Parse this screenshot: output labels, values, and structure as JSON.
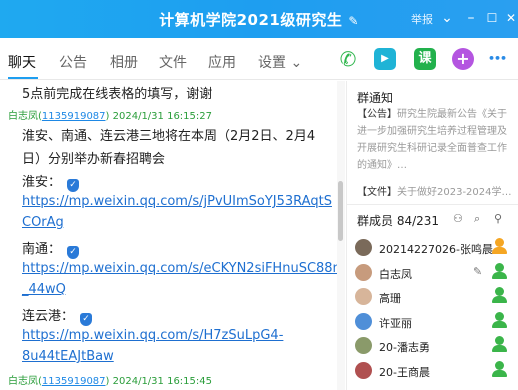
{
  "window": {
    "title": "计算机学院2021级研究生",
    "edit_glyph": "✎",
    "report": "举报",
    "btn_chevron": "⌄",
    "btn_min": "–",
    "btn_max": "☐",
    "btn_close": "✕"
  },
  "tabs": [
    {
      "label": "聊天"
    },
    {
      "label": "公告"
    },
    {
      "label": "相册"
    },
    {
      "label": "文件"
    },
    {
      "label": "应用"
    },
    {
      "label": "设置 ⌄"
    }
  ],
  "actions": {
    "call": "✆",
    "video": "▶",
    "class": "课",
    "add": "+",
    "more": "•••"
  },
  "colors": {
    "accent": "#1e9ef0",
    "owner": "#f5a623",
    "admin": "#3bb54a",
    "link": "#1e6fd0"
  },
  "chat": {
    "line0": "5点前完成在线表格的填写，谢谢",
    "msg1": {
      "name": "白志凤",
      "qq": "1135919087",
      "time": "2024/1/31 16:15:27"
    },
    "line1": "淮安、南通、连云港三地将在本周（2月2日、2月4",
    "line2": "日）分别举办新春招聘会",
    "city1": "淮安：",
    "link1a": "https://mp.weixin.qq.com/s/jPvUImSoYJ53RAqtS",
    "link1b": "COrAg",
    "city2": "南通：",
    "link2a": "https://mp.weixin.qq.com/s/eCKYN2siFHnuSC88n",
    "link2b": "_44wQ",
    "city3": "连云港：",
    "link3a": "https://mp.weixin.qq.com/s/H7zSuLpG4-",
    "link3b": "8u44tEAJtBaw",
    "msg2": {
      "name": "白志凤",
      "qq": "1135919087",
      "time": "2024/1/31 16:15:45"
    },
    "shield_glyph": "✓"
  },
  "notice": {
    "title": "群通知",
    "tag": "【公告】",
    "body": "研究生院最新公告《关于进一步加强研究生培养过程管理及开展研究生科研记录全面普查工作的通知》…",
    "file_tag": "【文件】",
    "file": "关于做好2023-2024学…"
  },
  "members": {
    "title": "群成员 84/231",
    "items": [
      {
        "name": "20214227026-张鸣晨",
        "role": "owner"
      },
      {
        "name": "白志凤",
        "role": "admin"
      },
      {
        "name": "高珊",
        "role": "admin"
      },
      {
        "name": "许亚丽",
        "role": "admin"
      },
      {
        "name": "20-潘志勇",
        "role": "admin"
      },
      {
        "name": "20-王商晨",
        "role": "admin"
      }
    ]
  }
}
